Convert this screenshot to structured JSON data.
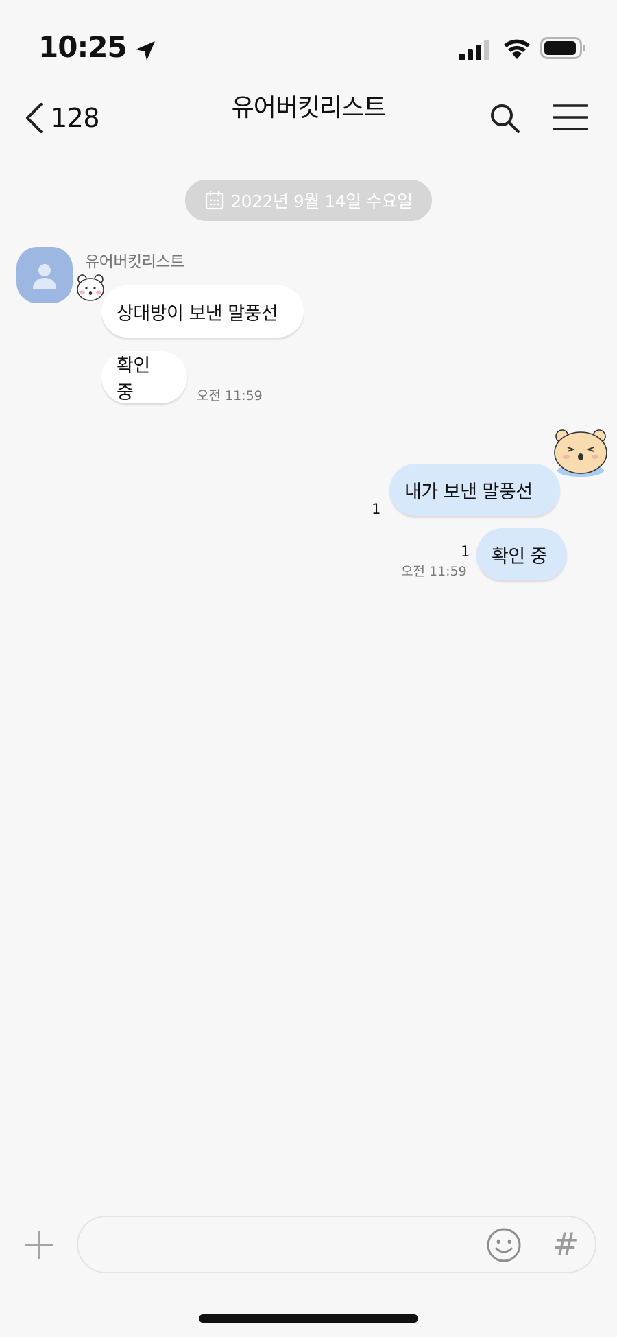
{
  "status_bar": {
    "time": "10:25",
    "icons": [
      "location-arrow-icon",
      "cellular-signal-icon",
      "wifi-icon",
      "battery-icon"
    ]
  },
  "header": {
    "back_count": "128",
    "title": "유어버킷리스트",
    "actions": [
      "search-icon",
      "menu-icon"
    ]
  },
  "date_divider": {
    "label": "2022년 9월 14일 수요일",
    "icon": "calendar-icon"
  },
  "incoming": {
    "sender": "유어버킷리스트",
    "messages": [
      {
        "text": "상대방이 보낸 말풍선"
      },
      {
        "text": "확인 중"
      }
    ],
    "time": "오전 11:59"
  },
  "outgoing": {
    "messages": [
      {
        "text": "내가 보낸 말풍선",
        "unread": "1"
      },
      {
        "text": "확인 중",
        "unread": "1"
      }
    ],
    "time": "오전 11:59"
  },
  "composer": {
    "placeholder": "",
    "hash_label": "#",
    "icons": [
      "plus-icon",
      "emoji-icon",
      "hashtag-icon"
    ]
  },
  "colors": {
    "background": "#f7f7f7",
    "outgoing_bubble": "#d8e8fb",
    "incoming_bubble": "#ffffff",
    "date_pill": "#d6d6d6",
    "avatar": "#9cb8e2"
  }
}
